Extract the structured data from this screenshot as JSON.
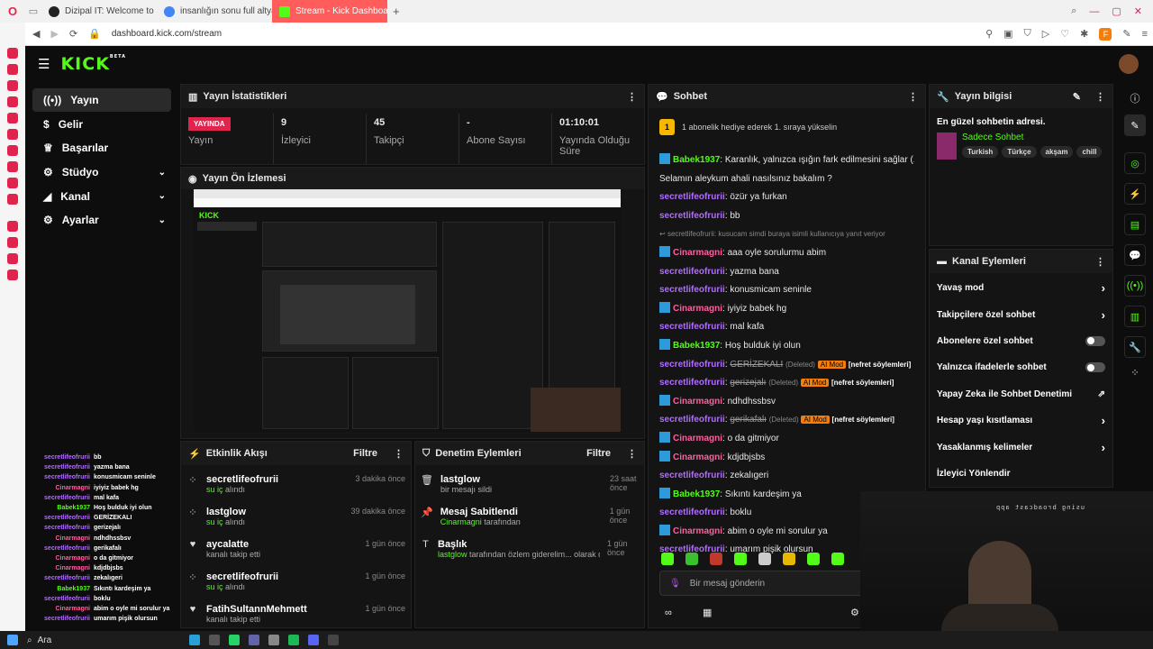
{
  "browser": {
    "tabs": [
      {
        "label": "Dizipal IT: Welcome to De",
        "color": "#222222"
      },
      {
        "label": "insanlığın sonu full altyaz",
        "color": "#4285f4"
      },
      {
        "label": "Stream - Kick Dashboard",
        "color": "#53fc18",
        "active": true
      }
    ],
    "url": "dashboard.kick.com/stream"
  },
  "app": {
    "logo": "KICK",
    "logo_sup": "BETA",
    "accent": "#53fc18"
  },
  "nav": [
    {
      "label": "Yayın",
      "active": true,
      "icon": "broadcast-icon"
    },
    {
      "label": "Gelir",
      "icon": "dollar-icon"
    },
    {
      "label": "Başarılar",
      "icon": "trophy-icon"
    },
    {
      "label": "Stüdyo",
      "icon": "gear-icon",
      "chevron": true
    },
    {
      "label": "Kanal",
      "icon": "megaphone-icon",
      "chevron": true
    },
    {
      "label": "Ayarlar",
      "icon": "settings-icon",
      "chevron": true
    }
  ],
  "stats": {
    "title": "Yayın İstatistikleri",
    "live_badge": "YAYINDA",
    "live_label": "Yayın",
    "items": [
      {
        "value": "9",
        "label": "İzleyici"
      },
      {
        "value": "45",
        "label": "Takipçi"
      },
      {
        "value": "-",
        "label": "Abone Sayısı"
      },
      {
        "value": "01:10:01",
        "label": "Yayında Olduğu Süre"
      }
    ]
  },
  "preview": {
    "title": "Yayın Ön İzlemesi"
  },
  "activity": {
    "title": "Etkinlik Akışı",
    "filter": "Filtre",
    "items": [
      {
        "user": "secretlifeofrurii",
        "sub": "su iç",
        "sub_rest": " alındı",
        "time": "3 dakika önce"
      },
      {
        "user": "lastglow",
        "sub": "su iç",
        "sub_rest": " alındı",
        "time": "39 dakika önce"
      },
      {
        "user": "aycalatte",
        "sub": "",
        "sub_rest": "kanalı takip etti",
        "time": "1 gün önce"
      },
      {
        "user": "secretlifeofrurii",
        "sub": "su iç",
        "sub_rest": " alındı",
        "time": "1 gün önce"
      },
      {
        "user": "FatihSultannMehmett",
        "sub": "",
        "sub_rest": "kanalı takip etti",
        "time": "1 gün önce"
      }
    ]
  },
  "moderation": {
    "title": "Denetim Eylemleri",
    "filter": "Filtre",
    "items": [
      {
        "title": "lastglow",
        "sub_user": "",
        "sub": "bir mesajı sildi",
        "time": "23 saat önce"
      },
      {
        "title": "Mesaj Sabitlendi",
        "sub_user": "Cinarmagni",
        "sub": " tarafından",
        "time": "1 gün önce"
      },
      {
        "title": "Başlık",
        "sub_user": "lastglow",
        "sub": " tarafından özlem giderelim... olarak değiştirildi",
        "time": "1 gün önce"
      }
    ]
  },
  "chat": {
    "title": "Sohbet",
    "pinned_count": "1",
    "pinned": "1 abonelik hediye ederek 1. sıraya yükselin",
    "input_placeholder": "Bir mesaj gönderin",
    "messages": [
      {
        "user": "Babek1937",
        "color": "green",
        "badge": true,
        "text": ": Karanlık, yalnızca ışığın fark edilmesini sağlar (.)"
      },
      {
        "user": "",
        "color": "",
        "text": "Selamın aleykum ahali nasılsınız bakalım ?"
      },
      {
        "user": "secretlifeofrurii",
        "color": "purple",
        "text": ": özür ya furkan"
      },
      {
        "user": "secretlifeofrurii",
        "color": "purple",
        "text": ": bb"
      },
      {
        "reply": "secretlifeofrurii: kusucam simdi buraya isimli kullanıcıya yanıt veriyor"
      },
      {
        "user": "Cinarmagni",
        "color": "pink",
        "badge": true,
        "text": ": aaa oyle sorulurmu abim"
      },
      {
        "user": "secretlifeofrurii",
        "color": "purple",
        "text": ": yazma bana"
      },
      {
        "user": "secretlifeofrurii",
        "color": "purple",
        "text": ": konusmicam seninle"
      },
      {
        "user": "Cinarmagni",
        "color": "pink",
        "badge": true,
        "text": ": iyiyiz babek hg"
      },
      {
        "user": "secretlifeofrurii",
        "color": "purple",
        "text": ": mal kafa"
      },
      {
        "user": "Babek1937",
        "color": "green",
        "badge": true,
        "text": ": Hoş bulduk iyi olun"
      },
      {
        "user": "secretlifeofrurii",
        "color": "purple",
        "deleted": "GERİZEKALI",
        "deleted_note": "(Deleted)",
        "mod": "AI Mod",
        "reason": "[nefret söylemleri]"
      },
      {
        "user": "secretlifeofrurii",
        "color": "purple",
        "deleted": "gerizejalı",
        "deleted_note": "(Deleted)",
        "mod": "AI Mod",
        "reason": "[nefret söylemleri]"
      },
      {
        "user": "Cinarmagni",
        "color": "pink",
        "badge": true,
        "text": ": ndhdhssbsv"
      },
      {
        "user": "secretlifeofrurii",
        "color": "purple",
        "deleted": "gerikafalı",
        "deleted_note": "(Deleted)",
        "mod": "AI Mod",
        "reason": "[nefret söylemleri]"
      },
      {
        "user": "Cinarmagni",
        "color": "pink",
        "badge": true,
        "text": ": o da gitmiyor"
      },
      {
        "user": "Cinarmagni",
        "color": "pink",
        "badge": true,
        "text": ": kdjdbjsbs"
      },
      {
        "user": "secretlifeofrurii",
        "color": "purple",
        "text": ": zekalıgeri"
      },
      {
        "user": "Babek1937",
        "color": "green",
        "badge": true,
        "text": ": Sıkıntı kardeşim ya"
      },
      {
        "user": "secretlifeofrurii",
        "color": "purple",
        "text": ": boklu"
      },
      {
        "user": "Cinarmagni",
        "color": "pink",
        "badge": true,
        "text": ": abim o oyle mi sorulur ya"
      },
      {
        "user": "secretlifeofrurii",
        "color": "purple",
        "text": ": umarım pişik olursun"
      }
    ]
  },
  "stream_info": {
    "title": "Yayın bilgisi",
    "description": "En güzel sohbetin adresi.",
    "category": "Sadece Sohbet",
    "tags": [
      "Turkish",
      "Türkçe",
      "akşam",
      "chill"
    ]
  },
  "channel_actions": {
    "title": "Kanal Eylemleri",
    "items": [
      {
        "label": "Yavaş mod",
        "control": "chevron"
      },
      {
        "label": "Takipçilere özel sohbet",
        "control": "chevron"
      },
      {
        "label": "Abonelere özel sohbet",
        "control": "toggle"
      },
      {
        "label": "Yalnızca ifadelerle sohbet",
        "control": "toggle"
      },
      {
        "label": "Yapay Zeka ile Sohbet Denetimi",
        "control": "external"
      },
      {
        "label": "Hesap yaşı kısıtlaması",
        "control": "chevron"
      },
      {
        "label": "Yasaklanmış kelimeler",
        "control": "chevron"
      },
      {
        "label": "İzleyici Yönlendir",
        "control": "none"
      }
    ]
  },
  "overlay_chat": [
    {
      "user": "secretlifeofrurii",
      "text": "bb"
    },
    {
      "user": "secretlifeofrurii",
      "text": "yazma bana"
    },
    {
      "user": "secretlifeofrurii",
      "text": "konusmicam seninle"
    },
    {
      "user": "Cinarmagni",
      "text": "iyiyiz babek hg"
    },
    {
      "user": "secretlifeofrurii",
      "text": "mal kafa"
    },
    {
      "user": "Babek1937",
      "text": "Hoş bulduk iyi olun"
    },
    {
      "user": "secretlifeofrurii",
      "text": "GERİZEKALI"
    },
    {
      "user": "secretlifeofrurii",
      "text": "gerizejalı"
    },
    {
      "user": "Cinarmagni",
      "text": "ndhdhssbsv"
    },
    {
      "user": "secretlifeofrurii",
      "text": "gerikafalı"
    },
    {
      "user": "Cinarmagni",
      "text": "o da gitmiyor"
    },
    {
      "user": "Cinarmagni",
      "text": "kdjdbjsbs"
    },
    {
      "user": "secretlifeofrurii",
      "text": "zekalıgeri"
    },
    {
      "user": "Babek1937",
      "text": "Sıkıntı kardeşim ya"
    },
    {
      "user": "secretlifeofrurii",
      "text": "boklu"
    },
    {
      "user": "Cinarmagni",
      "text": "abim o oyle mi sorulur ya"
    },
    {
      "user": "secretlifeofrurii",
      "text": "umarım pişik olursun"
    }
  ],
  "webcam_text": "using broadcast app",
  "taskbar": {
    "search": "Ara"
  }
}
